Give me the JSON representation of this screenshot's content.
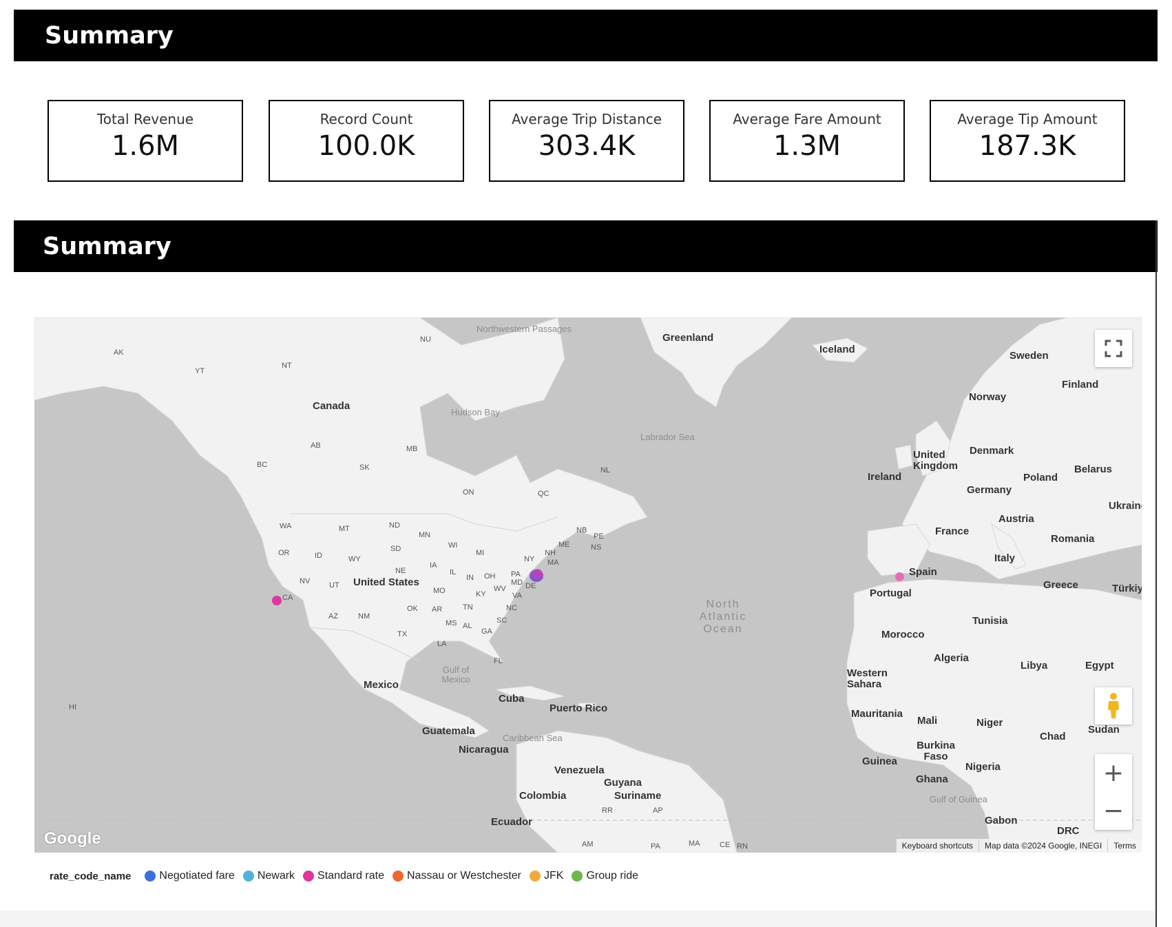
{
  "sections": [
    {
      "title": "Summary"
    },
    {
      "title": "Summary"
    }
  ],
  "kpis": [
    {
      "label": "Total Revenue",
      "value": "1.6M"
    },
    {
      "label": "Record Count",
      "value": "100.0K"
    },
    {
      "label": "Average Trip Distance",
      "value": "303.4K"
    },
    {
      "label": "Average Fare Amount",
      "value": "1.3M"
    },
    {
      "label": "Average Tip Amount",
      "value": "187.3K"
    }
  ],
  "map": {
    "labels": {
      "countries": [
        "Greenland",
        "Iceland",
        "Sweden",
        "Finland",
        "Norway",
        "Canada",
        "Denmark",
        "United Kingdom",
        "Ireland",
        "Poland",
        "Belarus",
        "Germany",
        "Ukraine",
        "Austria",
        "France",
        "Romania",
        "Italy",
        "Spain",
        "Portugal",
        "Greece",
        "Türkiy",
        "United States",
        "Tunisia",
        "Morocco",
        "Algeria",
        "Libya",
        "Egypt",
        "Western Sahara",
        "Mexico",
        "Cuba",
        "Puerto Rico",
        "Mauritania",
        "Mali",
        "Niger",
        "Chad",
        "Sudan",
        "Guatemala",
        "Nicaragua",
        "Burkina Faso",
        "Guinea",
        "Nigeria",
        "Venezuela",
        "Guyana",
        "Suriname",
        "Ghana",
        "Colombia",
        "Gabon",
        "Ecuador",
        "DRC"
      ],
      "regions": [
        "AK",
        "YT",
        "NT",
        "NU",
        "AB",
        "MB",
        "SK",
        "BC",
        "ON",
        "QC",
        "NL",
        "NB",
        "PE",
        "NS",
        "WA",
        "MT",
        "ND",
        "MN",
        "OR",
        "ID",
        "WY",
        "SD",
        "WI",
        "MI",
        "ME",
        "NH",
        "MA",
        "NY",
        "NV",
        "UT",
        "NE",
        "IA",
        "IL",
        "IN",
        "OH",
        "PA",
        "MD",
        "DE",
        "CA",
        "MO",
        "KY",
        "WV",
        "VA",
        "AZ",
        "NM",
        "OK",
        "AR",
        "TN",
        "NC",
        "MS",
        "AL",
        "SC",
        "GA",
        "TX",
        "LA",
        "FL",
        "HI",
        "RR",
        "AP",
        "AM",
        "PA",
        "MA",
        "CE",
        "RN"
      ],
      "water": [
        "Northwestern Passages",
        "Hudson Bay",
        "Labrador Sea",
        "Gulf of Mexico",
        "Caribbean Sea",
        "Gulf of Guinea"
      ],
      "ocean": "North Atlantic Ocean"
    },
    "markers": [
      {
        "category": "Standard rate",
        "lat": 34.0,
        "lon": -118.4
      },
      {
        "category": "Negotiated fare",
        "lat": 40.7,
        "lon": -74.0
      },
      {
        "category": "Standard rate",
        "lat": 40.75,
        "lon": -73.8
      },
      {
        "category": "Standard rate",
        "lat": 40.4,
        "lon": -3.7
      }
    ],
    "controls": {
      "zoom_in": "+",
      "zoom_out": "−"
    },
    "logo": "Google",
    "attribution": {
      "shortcuts": "Keyboard shortcuts",
      "data": "Map data ©2024 Google, INEGI",
      "terms": "Terms"
    }
  },
  "legend": {
    "title": "rate_code_name",
    "items": [
      {
        "label": "Negotiated fare",
        "color": "#3b6fe0"
      },
      {
        "label": "Newark",
        "color": "#4fb3d9"
      },
      {
        "label": "Standard rate",
        "color": "#e0369e"
      },
      {
        "label": "Nassau or Westchester",
        "color": "#e8692b"
      },
      {
        "label": "JFK",
        "color": "#f2a93b"
      },
      {
        "label": "Group ride",
        "color": "#6cb84a"
      }
    ]
  }
}
